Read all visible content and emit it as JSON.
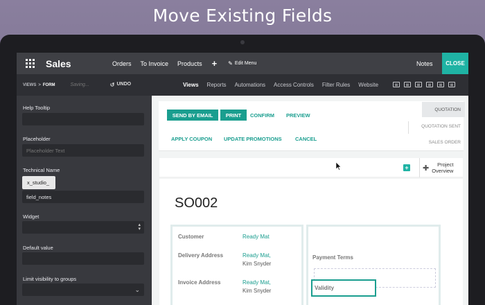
{
  "banner": {
    "title": "Move Existing Fields"
  },
  "topbar": {
    "app_title": "Sales",
    "menu": [
      "Orders",
      "To Invoice",
      "Products"
    ],
    "add_label": "+",
    "edit_menu": "Edit Menu",
    "notes": "Notes",
    "close": "CLOSE"
  },
  "subbar": {
    "crumb_views": "VIEWS",
    "crumb_sep": ">",
    "crumb_form": "FORM",
    "saving": "Saving...",
    "undo": "UNDO",
    "tabs": [
      "Views",
      "Reports",
      "Automations",
      "Access Controls",
      "Filter Rules",
      "Website"
    ],
    "active_tab": "Views"
  },
  "sidebar": {
    "help_tooltip_label": "Help Tooltip",
    "help_tooltip_value": "",
    "placeholder_label": "Placeholder",
    "placeholder_placeholder": "Placeholder Text",
    "technical_name_label": "Technical Name",
    "technical_name_prefix": "x_studio_",
    "technical_name_value": "field_notes",
    "widget_label": "Widget",
    "widget_value": "",
    "default_value_label": "Default value",
    "default_value": "",
    "visibility_label": "Limit visibility to groups",
    "visibility_value": ""
  },
  "form": {
    "buttons_primary": [
      "SEND BY EMAIL",
      "PRINT"
    ],
    "buttons_links_row1": [
      "CONFIRM",
      "PREVIEW"
    ],
    "buttons_links_row2": [
      "APPLY COUPON",
      "UPDATE PROMOTIONS",
      "CANCEL"
    ],
    "stages": [
      "QUOTATION",
      "QUOTATION SENT",
      "SALES ORDER"
    ],
    "active_stage": "QUOTATION",
    "project_overview": [
      "Project",
      "Overview"
    ],
    "record_name": "SO002",
    "customer_label": "Customer",
    "customer_value": "Ready Mat",
    "delivery_label": "Delivery Address",
    "delivery_value_1": "Ready Mat,",
    "delivery_value_2": "Kim Snyder",
    "invoice_label": "Invoice Address",
    "invoice_value_1": "Ready Mat,",
    "invoice_value_2": "Kim Snyder",
    "payment_terms_label": "Payment Terms",
    "validity_label": "Validity"
  },
  "colors": {
    "accent": "#1a9e8f",
    "close_btn": "#1fb3a4",
    "navbar": "#3f4045",
    "sidebar": "#38393e"
  }
}
